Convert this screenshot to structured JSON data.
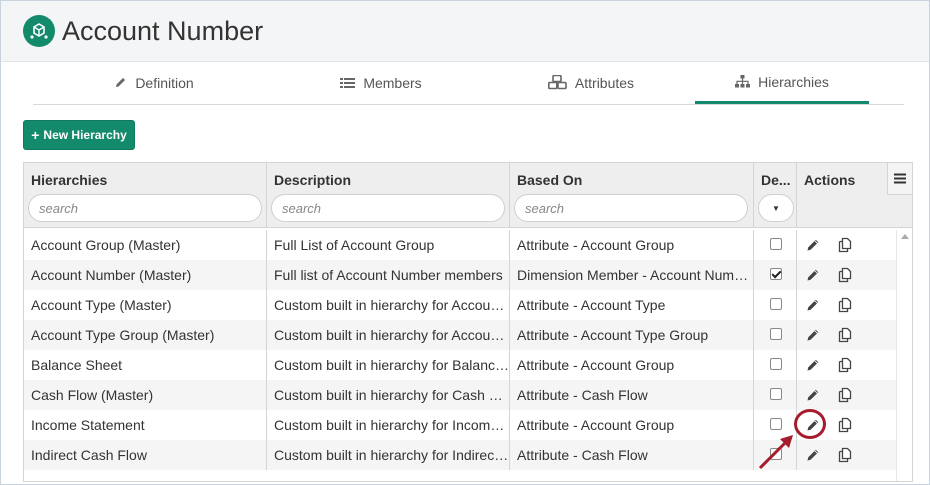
{
  "header": {
    "title": "Account Number",
    "app_icon": "cube-network-icon"
  },
  "tabs": [
    {
      "label": "Definition",
      "icon": "pencil-icon",
      "active": false
    },
    {
      "label": "Members",
      "icon": "list-icon",
      "active": false
    },
    {
      "label": "Attributes",
      "icon": "cubes-icon",
      "active": false
    },
    {
      "label": "Hierarchies",
      "icon": "sitemap-icon",
      "active": true
    }
  ],
  "toolbar": {
    "new_hierarchy_label": "New Hierarchy"
  },
  "grid": {
    "columns": [
      {
        "label": "Hierarchies",
        "filter_placeholder": "search"
      },
      {
        "label": "Description",
        "filter_placeholder": "search"
      },
      {
        "label": "Based On",
        "filter_placeholder": "search"
      },
      {
        "label": "De...",
        "filter_placeholder": ""
      },
      {
        "label": "Actions",
        "filter_placeholder": ""
      }
    ],
    "rows": [
      {
        "name": "Account Group (Master)",
        "description": "Full List of Account Group",
        "based_on": "Attribute - Account Group",
        "default": false
      },
      {
        "name": "Account Number (Master)",
        "description": "Full list of Account Number members",
        "based_on": "Dimension Member - Account Number",
        "default": true
      },
      {
        "name": "Account Type (Master)",
        "description": "Custom built in hierarchy for Account Type",
        "based_on": "Attribute - Account Type",
        "default": false
      },
      {
        "name": "Account Type Group (Master)",
        "description": "Custom built in hierarchy for Account Type Group",
        "based_on": "Attribute - Account Type Group",
        "default": false
      },
      {
        "name": "Balance Sheet",
        "description": "Custom built in hierarchy for Balance Sheet",
        "based_on": "Attribute - Account Group",
        "default": false
      },
      {
        "name": "Cash Flow (Master)",
        "description": "Custom built in hierarchy for Cash Flow",
        "based_on": "Attribute - Cash Flow",
        "default": false
      },
      {
        "name": "Income Statement",
        "description": "Custom built in hierarchy for Income Statement",
        "based_on": "Attribute - Account Group",
        "default": false
      },
      {
        "name": "Indirect Cash Flow",
        "description": "Custom built in hierarchy for Indirect Cash Flow",
        "based_on": "Attribute - Cash Flow",
        "default": false
      }
    ]
  },
  "colors": {
    "accent": "#148a6c",
    "callout": "#a51d2d"
  }
}
